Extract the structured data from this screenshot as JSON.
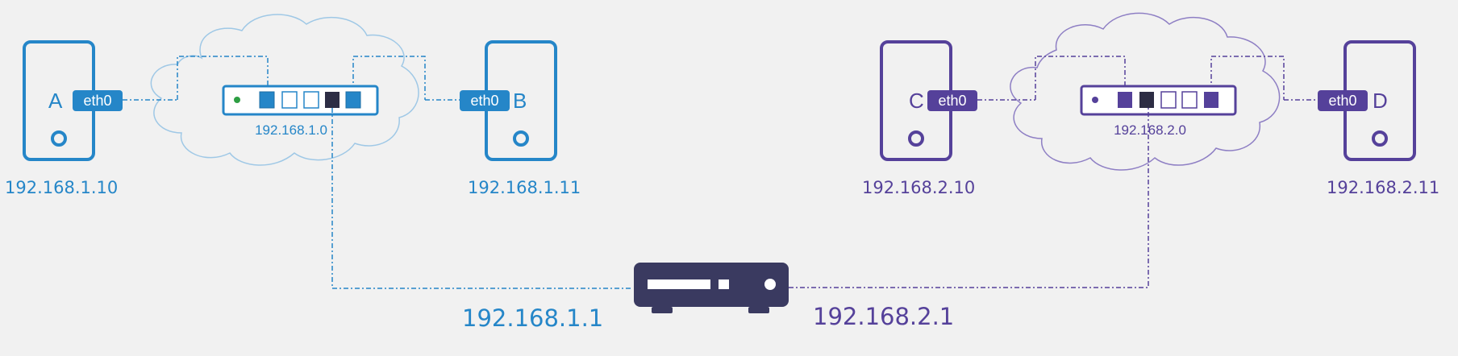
{
  "colors": {
    "net1": "#2586c8",
    "net1_cloud": "#9fc8e6",
    "net2": "#55419a",
    "net2_cloud": "#8e7fc4",
    "router": "#3a3a60",
    "background": "#f1f1f1",
    "dark_port": "#2d2d44",
    "green_led": "#2e9e43"
  },
  "network1": {
    "host_a": {
      "letter": "A",
      "iface": "eth0",
      "ip": "192.168.1.10"
    },
    "host_b": {
      "letter": "B",
      "iface": "eth0",
      "ip": "192.168.1.11"
    },
    "switch_label": "192.168.1.0",
    "gateway_ip": "192.168.1.1"
  },
  "network2": {
    "host_c": {
      "letter": "C",
      "iface": "eth0",
      "ip": "192.168.2.10"
    },
    "host_d": {
      "letter": "D",
      "iface": "eth0",
      "ip": "192.168.2.11"
    },
    "switch_label": "192.168.2.0",
    "gateway_ip": "192.168.2.1"
  },
  "icons": [
    "server-icon",
    "cloud-icon",
    "switch-icon",
    "router-icon"
  ]
}
